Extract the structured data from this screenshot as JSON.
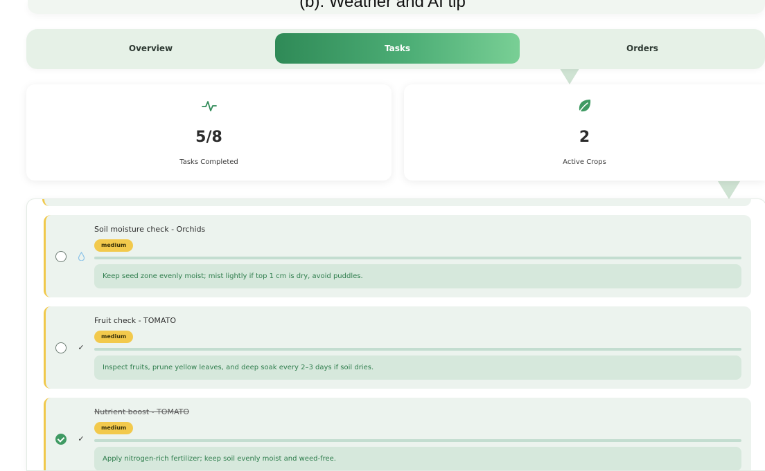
{
  "caption": "(b). Weather and AI tip",
  "tabs": {
    "overview": "Overview",
    "tasks": "Tasks",
    "orders": "Orders",
    "active": "Tasks"
  },
  "stats": {
    "tasks_completed": {
      "icon": "activity-pulse-icon",
      "value": "5/8",
      "label": "Tasks Completed"
    },
    "active_crops": {
      "icon": "leaf-icon",
      "value": "2",
      "label": "Active Crops"
    }
  },
  "tasks": [
    {
      "title": "Soil moisture check - Orchids",
      "priority": "medium",
      "type_icon": "water-drop-icon",
      "completed": false,
      "tip": "Keep seed zone evenly moist; mist lightly if top 1 cm is dry, avoid puddles."
    },
    {
      "title": "Fruit check - TOMATO",
      "priority": "medium",
      "type_icon": "checkmark-icon",
      "completed": false,
      "tip": "Inspect fruits, prune yellow leaves, and deep soak every 2–3 days if soil dries."
    },
    {
      "title": "Nutrient boost - TOMATO",
      "priority": "medium",
      "type_icon": "checkmark-icon",
      "completed": true,
      "tip": "Apply nitrogen-rich fertilizer; keep soil evenly moist and weed-free."
    }
  ],
  "colors": {
    "accent_green": "#2f8a57",
    "priority_yellow": "#f2c94c",
    "card_bg": "#ecf3ee",
    "tip_text": "#2e7d4c"
  }
}
